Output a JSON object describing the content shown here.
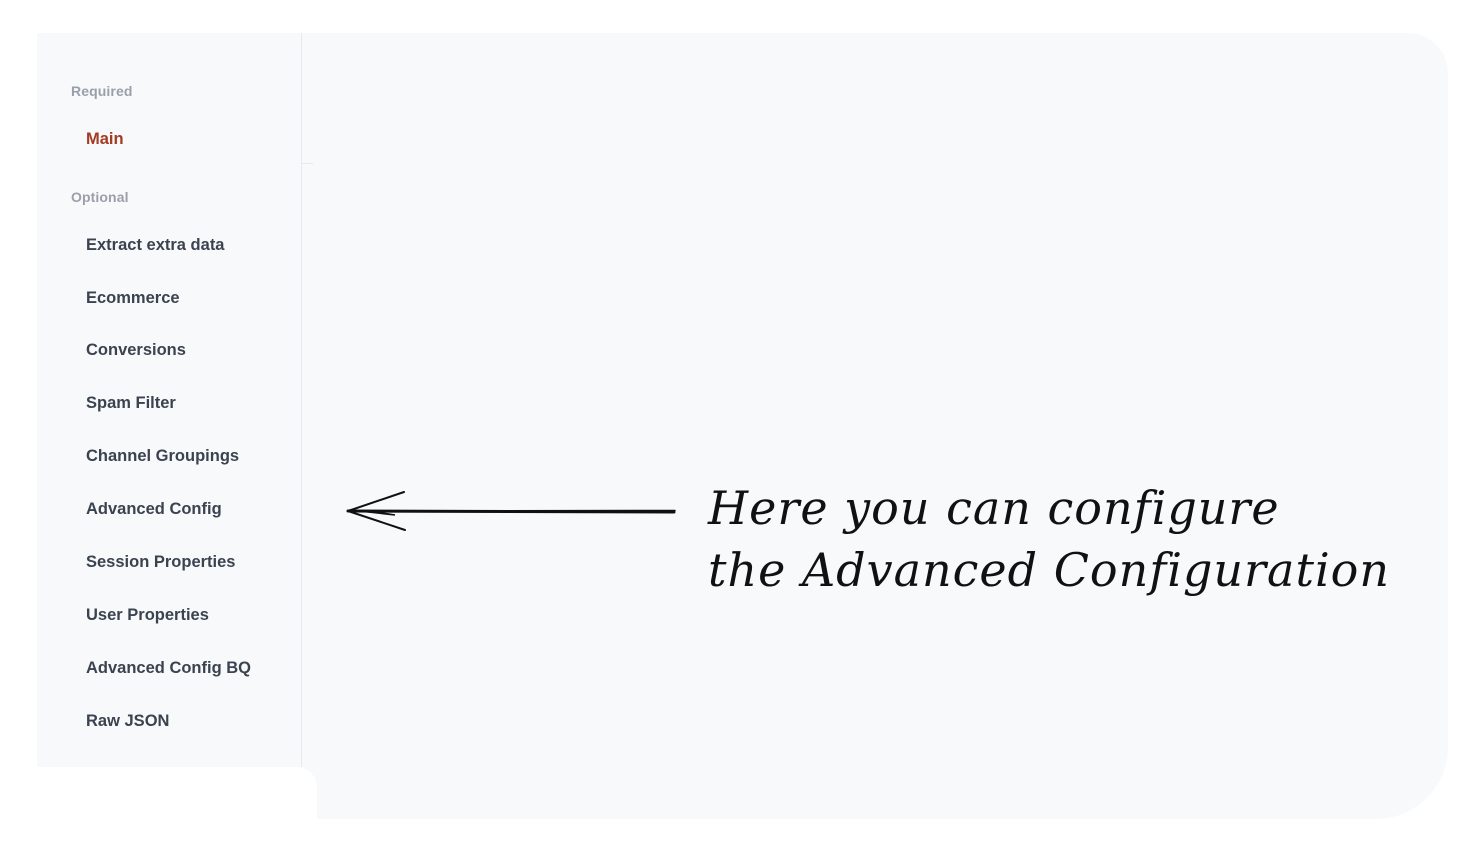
{
  "sidebar": {
    "required_label": "Required",
    "optional_label": "Optional",
    "required_items": [
      {
        "label": "Main",
        "active": true
      }
    ],
    "optional_items": [
      {
        "label": "Extract extra data"
      },
      {
        "label": "Ecommerce"
      },
      {
        "label": "Conversions"
      },
      {
        "label": "Spam Filter"
      },
      {
        "label": "Channel Groupings"
      },
      {
        "label": "Advanced Config"
      },
      {
        "label": "Session Properties"
      },
      {
        "label": "User Properties"
      },
      {
        "label": "Advanced Config BQ"
      },
      {
        "label": "Raw JSON"
      }
    ]
  },
  "annotation": {
    "line1": "Here you can configure",
    "line2": "the Advanced Configuration"
  },
  "colors": {
    "active": "#a53a22",
    "item": "#3b4350",
    "section": "#9aa0aa",
    "panel": "#f8f9fb"
  }
}
